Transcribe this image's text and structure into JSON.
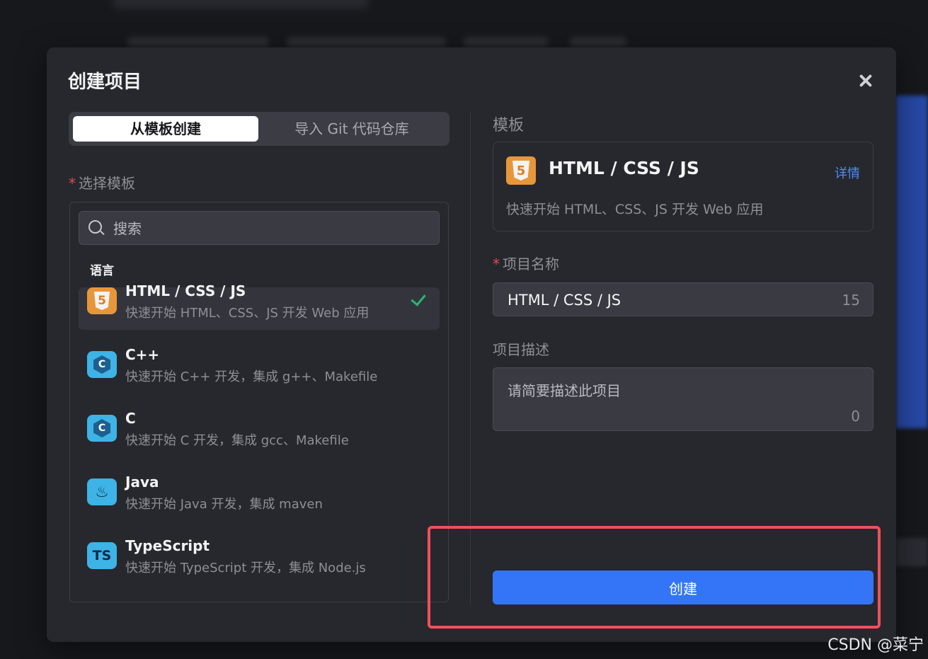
{
  "dialog": {
    "title": "创建项目"
  },
  "tabs": [
    {
      "label": "从模板创建",
      "active": true
    },
    {
      "label": "导入 Git 代码仓库",
      "active": false
    }
  ],
  "template_picker": {
    "required_mark": "*",
    "label": "选择模板",
    "search_placeholder": "搜索",
    "group_label": "语言",
    "items": [
      {
        "name": "HTML / CSS / JS",
        "desc": "快速开始 HTML、CSS、JS 开发 Web 应用",
        "icon": "html5-icon",
        "icon_text": "5",
        "selected": true
      },
      {
        "name": "C++",
        "desc": "快速开始 C++ 开发，集成 g++、Makefile",
        "icon": "cpp-icon",
        "icon_text": "C",
        "selected": false
      },
      {
        "name": "C",
        "desc": "快速开始 C 开发，集成 gcc、Makefile",
        "icon": "c-icon",
        "icon_text": "C",
        "selected": false
      },
      {
        "name": "Java",
        "desc": "快速开始 Java 开发，集成 maven",
        "icon": "java-icon",
        "icon_text": "♨",
        "selected": false
      },
      {
        "name": "TypeScript",
        "desc": "快速开始 TypeScript 开发，集成 Node.js",
        "icon": "typescript-icon",
        "icon_text": "TS",
        "selected": false
      }
    ]
  },
  "template_detail": {
    "label": "模板",
    "name": "HTML / CSS / JS",
    "icon_text": "5",
    "detail_link": "详情",
    "desc": "快速开始 HTML、CSS、JS 开发 Web 应用"
  },
  "project_name": {
    "required_mark": "*",
    "label": "项目名称",
    "value": "HTML / CSS / JS",
    "count": "15"
  },
  "project_desc": {
    "label": "项目描述",
    "placeholder": "请简要描述此项目",
    "count": "0"
  },
  "create_button": {
    "label": "创建"
  },
  "watermark": "CSDN @菜宁",
  "colors": {
    "accent": "#3375f6",
    "highlight": "#f0505c",
    "check": "#2bb673",
    "link": "#4a8df7"
  }
}
